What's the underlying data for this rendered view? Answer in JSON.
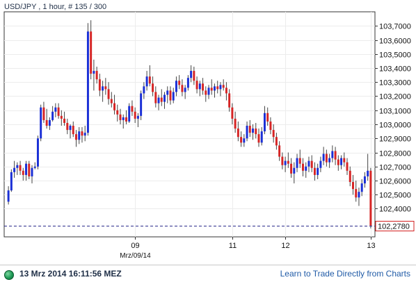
{
  "header": {
    "title": "USD/JPY , 1 hour, # 135 / 300"
  },
  "footer": {
    "timestamp": "13 Mrz 2014 16:11:56 MEZ",
    "link": "Learn to Trade Directly from Charts"
  },
  "icons": {
    "status": "live-status-icon"
  },
  "colors": {
    "up": "#1a2fd6",
    "down": "#d62424",
    "price_line": "#2a2a8a",
    "axis": "#333333"
  },
  "chart_data": {
    "type": "candlestick",
    "title": "USD/JPY , 1 hour, # 135 / 300",
    "ylim": [
      102.2,
      103.8
    ],
    "y_ticks": [
      "102,4000",
      "102,5000",
      "102,6000",
      "102,7000",
      "102,8000",
      "102,9000",
      "103,0000",
      "103,1000",
      "103,2000",
      "103,3000",
      "103,4000",
      "103,5000",
      "103,6000",
      "103,7000"
    ],
    "x_tick_labels": [
      {
        "label": "09",
        "index": 43
      },
      {
        "label": "Mrz/09/14",
        "index": 43
      },
      {
        "label": "11",
        "index": 76
      },
      {
        "label": "12",
        "index": 94
      },
      {
        "label": "13",
        "index": 123
      }
    ],
    "current_price": 102.278,
    "current_price_label": "102,2780",
    "candles": [
      [
        102.45,
        102.56,
        102.43,
        102.53
      ],
      [
        102.53,
        102.68,
        102.52,
        102.66
      ],
      [
        102.66,
        102.74,
        102.62,
        102.69
      ],
      [
        102.69,
        102.73,
        102.64,
        102.71
      ],
      [
        102.71,
        102.74,
        102.64,
        102.67
      ],
      [
        102.67,
        102.69,
        102.6,
        102.64
      ],
      [
        102.64,
        102.74,
        102.6,
        102.72
      ],
      [
        102.72,
        102.74,
        102.61,
        102.63
      ],
      [
        102.63,
        102.71,
        102.58,
        102.69
      ],
      [
        102.69,
        102.73,
        102.68,
        102.7
      ],
      [
        102.7,
        102.92,
        102.68,
        102.9
      ],
      [
        102.9,
        103.14,
        102.88,
        103.12
      ],
      [
        103.12,
        103.16,
        103.01,
        103.03
      ],
      [
        103.03,
        103.11,
        102.97,
        102.99
      ],
      [
        102.99,
        103.05,
        102.96,
        103.03
      ],
      [
        103.03,
        103.13,
        103.02,
        103.09
      ],
      [
        103.09,
        103.15,
        103.05,
        103.12
      ],
      [
        103.12,
        103.15,
        103.04,
        103.06
      ],
      [
        103.06,
        103.1,
        102.99,
        103.04
      ],
      [
        103.04,
        103.09,
        102.99,
        103.01
      ],
      [
        103.01,
        103.04,
        102.93,
        102.96
      ],
      [
        102.96,
        103.0,
        102.9,
        102.99
      ],
      [
        102.99,
        103.02,
        102.91,
        102.93
      ],
      [
        102.93,
        102.96,
        102.84,
        102.89
      ],
      [
        102.89,
        102.98,
        102.86,
        102.95
      ],
      [
        102.95,
        102.98,
        102.87,
        102.92
      ],
      [
        102.92,
        102.99,
        102.88,
        102.94
      ],
      [
        102.94,
        103.72,
        102.92,
        103.66
      ],
      [
        103.66,
        103.74,
        103.32,
        103.36
      ],
      [
        103.36,
        103.46,
        103.24,
        103.38
      ],
      [
        103.38,
        103.41,
        103.29,
        103.32
      ],
      [
        103.32,
        103.36,
        103.2,
        103.24
      ],
      [
        103.24,
        103.31,
        103.16,
        103.27
      ],
      [
        103.27,
        103.33,
        103.21,
        103.25
      ],
      [
        103.25,
        103.3,
        103.14,
        103.18
      ],
      [
        103.18,
        103.23,
        103.12,
        103.15
      ],
      [
        103.15,
        103.21,
        103.07,
        103.1
      ],
      [
        103.1,
        103.14,
        103.02,
        103.07
      ],
      [
        103.07,
        103.11,
        103.0,
        103.03
      ],
      [
        103.03,
        103.07,
        102.97,
        103.05
      ],
      [
        103.05,
        103.1,
        103.0,
        103.02
      ],
      [
        103.02,
        103.15,
        103.01,
        103.13
      ],
      [
        103.13,
        103.17,
        103.06,
        103.09
      ],
      [
        103.09,
        103.12,
        103.01,
        103.04
      ],
      [
        103.04,
        103.08,
        102.98,
        103.06
      ],
      [
        103.06,
        103.24,
        103.03,
        103.22
      ],
      [
        103.22,
        103.3,
        103.18,
        103.27
      ],
      [
        103.27,
        103.38,
        103.24,
        103.34
      ],
      [
        103.34,
        103.42,
        103.27,
        103.29
      ],
      [
        103.29,
        103.34,
        103.2,
        103.23
      ],
      [
        103.23,
        103.27,
        103.12,
        103.15
      ],
      [
        103.15,
        103.21,
        103.1,
        103.19
      ],
      [
        103.19,
        103.25,
        103.13,
        103.16
      ],
      [
        103.16,
        103.23,
        103.11,
        103.21
      ],
      [
        103.21,
        103.27,
        103.15,
        103.24
      ],
      [
        103.24,
        103.27,
        103.14,
        103.17
      ],
      [
        103.17,
        103.26,
        103.15,
        103.23
      ],
      [
        103.23,
        103.34,
        103.2,
        103.31
      ],
      [
        103.31,
        103.35,
        103.25,
        103.28
      ],
      [
        103.28,
        103.32,
        103.2,
        103.23
      ],
      [
        103.23,
        103.28,
        103.18,
        103.26
      ],
      [
        103.26,
        103.35,
        103.24,
        103.33
      ],
      [
        103.33,
        103.42,
        103.3,
        103.38
      ],
      [
        103.38,
        103.41,
        103.28,
        103.31
      ],
      [
        103.31,
        103.34,
        103.22,
        103.25
      ],
      [
        103.25,
        103.31,
        103.2,
        103.29
      ],
      [
        103.29,
        103.33,
        103.21,
        103.24
      ],
      [
        103.24,
        103.27,
        103.16,
        103.21
      ],
      [
        103.21,
        103.28,
        103.18,
        103.26
      ],
      [
        103.26,
        103.32,
        103.21,
        103.24
      ],
      [
        103.24,
        103.29,
        103.19,
        103.27
      ],
      [
        103.27,
        103.31,
        103.22,
        103.25
      ],
      [
        103.25,
        103.3,
        103.2,
        103.28
      ],
      [
        103.28,
        103.32,
        103.24,
        103.26
      ],
      [
        103.26,
        103.3,
        103.17,
        103.22
      ],
      [
        103.22,
        103.25,
        103.09,
        103.12
      ],
      [
        103.12,
        103.15,
        103.0,
        103.04
      ],
      [
        103.04,
        103.09,
        102.94,
        102.97
      ],
      [
        102.97,
        103.02,
        102.88,
        102.91
      ],
      [
        102.91,
        102.95,
        102.84,
        102.87
      ],
      [
        102.87,
        102.93,
        102.84,
        102.9
      ],
      [
        102.9,
        103.02,
        102.88,
        102.99
      ],
      [
        102.99,
        103.03,
        102.91,
        102.94
      ],
      [
        102.94,
        103.0,
        102.89,
        102.97
      ],
      [
        102.97,
        103.01,
        102.9,
        102.93
      ],
      [
        102.93,
        102.97,
        102.84,
        102.87
      ],
      [
        102.87,
        102.98,
        102.85,
        102.95
      ],
      [
        102.95,
        103.13,
        102.93,
        103.08
      ],
      [
        103.08,
        103.12,
        102.99,
        103.02
      ],
      [
        103.02,
        103.05,
        102.93,
        102.96
      ],
      [
        102.96,
        103.0,
        102.87,
        102.91
      ],
      [
        102.91,
        102.94,
        102.82,
        102.85
      ],
      [
        102.85,
        102.88,
        102.74,
        102.77
      ],
      [
        102.77,
        102.8,
        102.68,
        102.71
      ],
      [
        102.71,
        102.77,
        102.66,
        102.74
      ],
      [
        102.74,
        102.8,
        102.69,
        102.72
      ],
      [
        102.72,
        102.76,
        102.62,
        102.65
      ],
      [
        102.65,
        102.73,
        102.58,
        102.69
      ],
      [
        102.69,
        102.79,
        102.66,
        102.76
      ],
      [
        102.76,
        102.82,
        102.69,
        102.72
      ],
      [
        102.72,
        102.76,
        102.63,
        102.67
      ],
      [
        102.67,
        102.73,
        102.62,
        102.7
      ],
      [
        102.7,
        102.77,
        102.66,
        102.74
      ],
      [
        102.74,
        102.78,
        102.66,
        102.69
      ],
      [
        102.69,
        102.73,
        102.6,
        102.64
      ],
      [
        102.64,
        102.72,
        102.61,
        102.69
      ],
      [
        102.69,
        102.77,
        102.66,
        102.74
      ],
      [
        102.74,
        102.84,
        102.71,
        102.79
      ],
      [
        102.79,
        102.82,
        102.7,
        102.73
      ],
      [
        102.73,
        102.79,
        102.69,
        102.76
      ],
      [
        102.76,
        102.85,
        102.73,
        102.81
      ],
      [
        102.81,
        102.84,
        102.71,
        102.75
      ],
      [
        102.75,
        102.78,
        102.67,
        102.71
      ],
      [
        102.71,
        102.78,
        102.68,
        102.76
      ],
      [
        102.76,
        102.8,
        102.7,
        102.73
      ],
      [
        102.73,
        102.76,
        102.64,
        102.67
      ],
      [
        102.67,
        102.7,
        102.56,
        102.59
      ],
      [
        102.59,
        102.64,
        102.5,
        102.54
      ],
      [
        102.54,
        102.6,
        102.45,
        102.48
      ],
      [
        102.48,
        102.55,
        102.42,
        102.52
      ],
      [
        102.52,
        102.61,
        102.49,
        102.58
      ],
      [
        102.58,
        102.66,
        102.55,
        102.63
      ],
      [
        102.63,
        102.79,
        102.6,
        102.67
      ],
      [
        102.67,
        102.69,
        102.26,
        102.28
      ]
    ]
  }
}
